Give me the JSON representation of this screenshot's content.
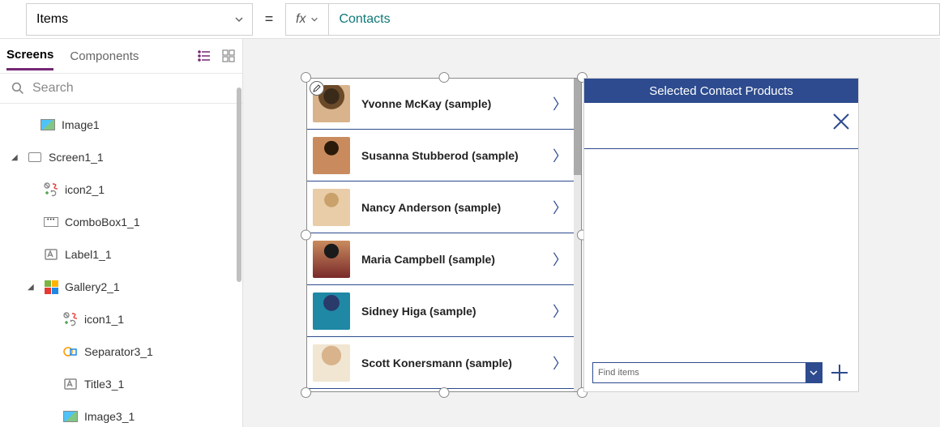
{
  "topbar": {
    "property": "Items",
    "fx_label": "fx",
    "formula": "Contacts",
    "equals": "="
  },
  "leftPanel": {
    "tabs": {
      "screens": "Screens",
      "components": "Components"
    },
    "search_placeholder": "Search",
    "tree": {
      "image1": "Image1",
      "screen1_1": "Screen1_1",
      "icon2_1": "icon2_1",
      "combobox1_1": "ComboBox1_1",
      "label1_1": "Label1_1",
      "gallery2_1": "Gallery2_1",
      "icon1_1": "icon1_1",
      "separator3_1": "Separator3_1",
      "title3_1": "Title3_1",
      "image3_1": "Image3_1"
    }
  },
  "gallery": {
    "rows": [
      "Yvonne McKay (sample)",
      "Susanna Stubberod (sample)",
      "Nancy Anderson (sample)",
      "Maria Campbell (sample)",
      "Sidney Higa (sample)",
      "Scott Konersmann (sample)"
    ]
  },
  "rightForm": {
    "title": "Selected Contact Products",
    "combo_placeholder": "Find items"
  }
}
